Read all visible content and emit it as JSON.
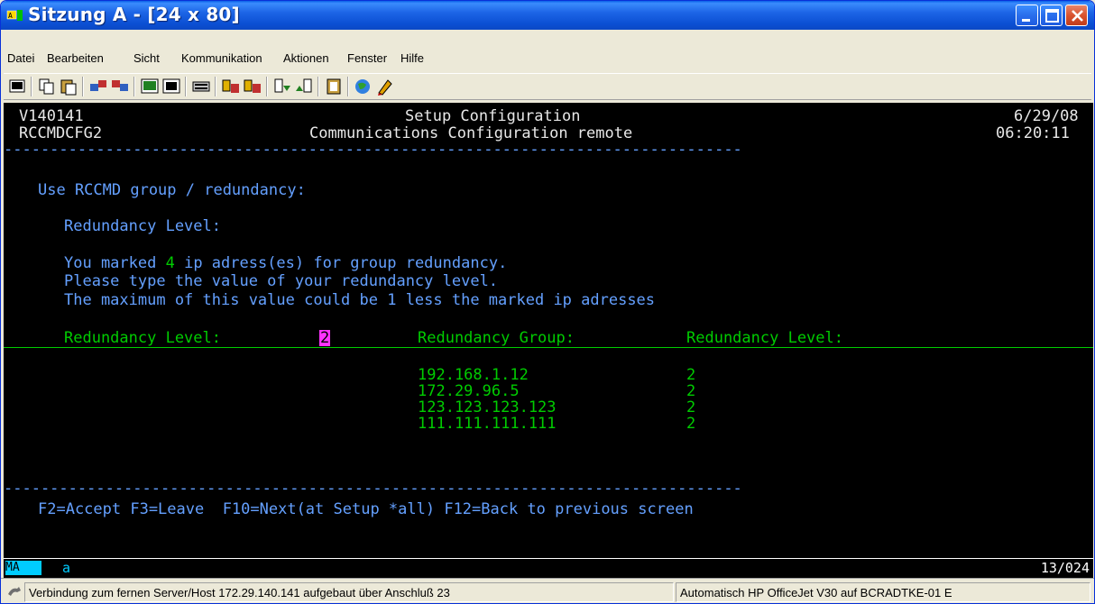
{
  "window": {
    "title": "Sitzung A - [24 x 80]"
  },
  "menu": [
    "Datei",
    "Bearbeiten",
    "Sicht",
    "Kommunikation",
    "Aktionen",
    "Fenster",
    "Hilfe"
  ],
  "terminal": {
    "header": {
      "user_id": "V140141",
      "program": "RCCMDCFG2",
      "title1": "Setup Configuration",
      "title2": "Communications Configuration remote",
      "date": "6/29/08",
      "time": "06:20:11"
    },
    "rule": "--------------------------------------------------------------------------------",
    "group_heading": "Use RCCMD group / redundancy:",
    "level_heading": "Redundancy Level:",
    "info_pre": "You marked ",
    "info_count": "4",
    "info_post": " ip adress(es) for group redundancy.",
    "info_line2": "Please type the value of your redundancy level.",
    "info_line3": "The maximum of this value could be 1 less the marked ip adresses",
    "field_label": "Redundancy Level:",
    "field_value": "2",
    "col_group": "Redundancy Group:",
    "col_level": "Redundancy Level:",
    "rows": [
      {
        "ip": "192.168.1.12",
        "level": "2"
      },
      {
        "ip": "172.29.96.5",
        "level": "2"
      },
      {
        "ip": "123.123.123.123",
        "level": "2"
      },
      {
        "ip": "111.111.111.111",
        "level": "2"
      }
    ],
    "function_keys": "F2=Accept F3=Leave  F10=Next(at Setup *all) F12=Back to previous screen"
  },
  "oia": {
    "mode": "MA",
    "indicator": "a",
    "cursor_pos": "13/024"
  },
  "status": {
    "connection": "Verbindung zum fernen Server/Host 172.29.140.141 aufgebaut über Anschluß 23",
    "printer": "Automatisch HP OfficeJet V30 auf BCRADTKE-01 E"
  },
  "colors": {
    "terminal_bg": "#000000",
    "text_white": "#E8E8E8",
    "text_green": "#00CC00",
    "text_blue": "#64A0FF",
    "cursor_field": "#FF33FF",
    "titlebar": "#0B4FD3"
  }
}
